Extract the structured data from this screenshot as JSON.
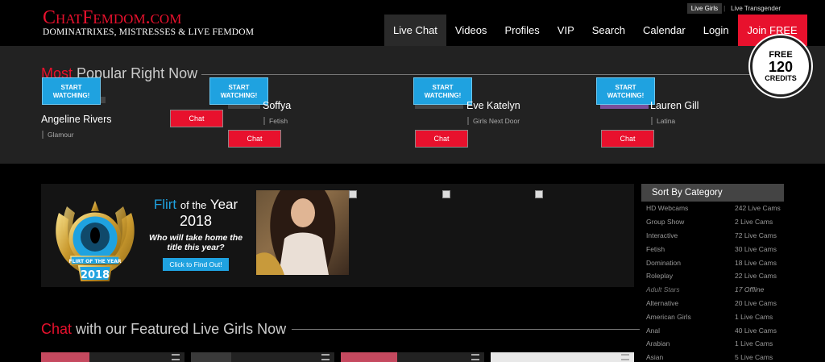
{
  "header": {
    "logo_brand": "ChatFemdom.com",
    "logo_tagline": "Dominatrixes, Mistresses & Live Femdom",
    "top_links": [
      "Live Girls",
      "Live Transgender"
    ],
    "nav": [
      "Live Chat",
      "Videos",
      "Profiles",
      "VIP",
      "Search",
      "Calendar",
      "Login"
    ],
    "join_label": "Join FREE",
    "badge": {
      "line1": "FREE",
      "line2": "120",
      "line3": "CREDITS"
    }
  },
  "popular": {
    "title_highlight": "Most",
    "title_rest": "Popular Right Now",
    "start_watching": "START WATCHING!",
    "chat_label": "Chat",
    "performers": [
      {
        "name": "Angeline Rivers",
        "category": "Glamour"
      },
      {
        "name": "Soffya",
        "category": "Fetish"
      },
      {
        "name": "Eve Katelyn",
        "category": "Girls Next Door"
      },
      {
        "name": "Lauren Gill",
        "category": "Latina"
      }
    ]
  },
  "banner": {
    "award_label": "FLIRT OF THE YEAR",
    "award_year": "2018",
    "flirt_word": "Flirt",
    "of_the": "of the",
    "year_word": "Year",
    "year": "2018",
    "question": "Who will take home the title this year?",
    "cta": "Click to Find Out!"
  },
  "sort": {
    "title": "Sort By Category",
    "categories": [
      {
        "name": "HD Webcams",
        "count": "242 Live Cams"
      },
      {
        "name": "Group Show",
        "count": "2 Live Cams"
      },
      {
        "name": "Interactive",
        "count": "72 Live Cams"
      },
      {
        "name": "Fetish",
        "count": "30 Live Cams"
      },
      {
        "name": "Domination",
        "count": "18 Live Cams"
      },
      {
        "name": "Roleplay",
        "count": "22 Live Cams"
      },
      {
        "name": "Adult Stars",
        "count": "17 Offline"
      },
      {
        "name": "Alternative",
        "count": "20 Live Cams"
      },
      {
        "name": "American Girls",
        "count": "1 Live Cams"
      },
      {
        "name": "Anal",
        "count": "40 Live Cams"
      },
      {
        "name": "Arabian",
        "count": "1 Live Cams"
      },
      {
        "name": "Asian",
        "count": "5 Live Cams"
      }
    ]
  },
  "featured": {
    "title_highlight": "Chat",
    "title_rest": "with our Featured Live Girls Now"
  }
}
